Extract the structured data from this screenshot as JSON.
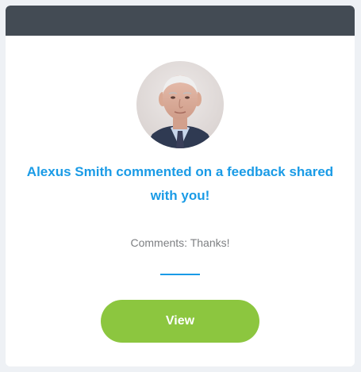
{
  "notification": {
    "avatar_icon": "person-avatar",
    "title": "Alexus Smith commented on a feedback shared with you!",
    "comment": "Comments: Thanks!",
    "view_button_label": "View"
  },
  "colors": {
    "header": "#434b54",
    "accent": "#1a9be6",
    "button": "#8cc63f"
  }
}
